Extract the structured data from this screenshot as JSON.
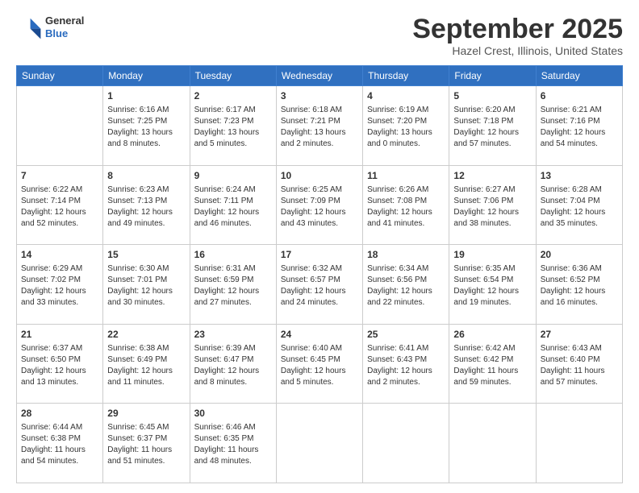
{
  "header": {
    "logo": {
      "line1": "General",
      "line2": "Blue"
    },
    "title": "September 2025",
    "location": "Hazel Crest, Illinois, United States"
  },
  "weekdays": [
    "Sunday",
    "Monday",
    "Tuesday",
    "Wednesday",
    "Thursday",
    "Friday",
    "Saturday"
  ],
  "weeks": [
    [
      {
        "day": "",
        "info": ""
      },
      {
        "day": "1",
        "info": "Sunrise: 6:16 AM\nSunset: 7:25 PM\nDaylight: 13 hours\nand 8 minutes."
      },
      {
        "day": "2",
        "info": "Sunrise: 6:17 AM\nSunset: 7:23 PM\nDaylight: 13 hours\nand 5 minutes."
      },
      {
        "day": "3",
        "info": "Sunrise: 6:18 AM\nSunset: 7:21 PM\nDaylight: 13 hours\nand 2 minutes."
      },
      {
        "day": "4",
        "info": "Sunrise: 6:19 AM\nSunset: 7:20 PM\nDaylight: 13 hours\nand 0 minutes."
      },
      {
        "day": "5",
        "info": "Sunrise: 6:20 AM\nSunset: 7:18 PM\nDaylight: 12 hours\nand 57 minutes."
      },
      {
        "day": "6",
        "info": "Sunrise: 6:21 AM\nSunset: 7:16 PM\nDaylight: 12 hours\nand 54 minutes."
      }
    ],
    [
      {
        "day": "7",
        "info": "Sunrise: 6:22 AM\nSunset: 7:14 PM\nDaylight: 12 hours\nand 52 minutes."
      },
      {
        "day": "8",
        "info": "Sunrise: 6:23 AM\nSunset: 7:13 PM\nDaylight: 12 hours\nand 49 minutes."
      },
      {
        "day": "9",
        "info": "Sunrise: 6:24 AM\nSunset: 7:11 PM\nDaylight: 12 hours\nand 46 minutes."
      },
      {
        "day": "10",
        "info": "Sunrise: 6:25 AM\nSunset: 7:09 PM\nDaylight: 12 hours\nand 43 minutes."
      },
      {
        "day": "11",
        "info": "Sunrise: 6:26 AM\nSunset: 7:08 PM\nDaylight: 12 hours\nand 41 minutes."
      },
      {
        "day": "12",
        "info": "Sunrise: 6:27 AM\nSunset: 7:06 PM\nDaylight: 12 hours\nand 38 minutes."
      },
      {
        "day": "13",
        "info": "Sunrise: 6:28 AM\nSunset: 7:04 PM\nDaylight: 12 hours\nand 35 minutes."
      }
    ],
    [
      {
        "day": "14",
        "info": "Sunrise: 6:29 AM\nSunset: 7:02 PM\nDaylight: 12 hours\nand 33 minutes."
      },
      {
        "day": "15",
        "info": "Sunrise: 6:30 AM\nSunset: 7:01 PM\nDaylight: 12 hours\nand 30 minutes."
      },
      {
        "day": "16",
        "info": "Sunrise: 6:31 AM\nSunset: 6:59 PM\nDaylight: 12 hours\nand 27 minutes."
      },
      {
        "day": "17",
        "info": "Sunrise: 6:32 AM\nSunset: 6:57 PM\nDaylight: 12 hours\nand 24 minutes."
      },
      {
        "day": "18",
        "info": "Sunrise: 6:34 AM\nSunset: 6:56 PM\nDaylight: 12 hours\nand 22 minutes."
      },
      {
        "day": "19",
        "info": "Sunrise: 6:35 AM\nSunset: 6:54 PM\nDaylight: 12 hours\nand 19 minutes."
      },
      {
        "day": "20",
        "info": "Sunrise: 6:36 AM\nSunset: 6:52 PM\nDaylight: 12 hours\nand 16 minutes."
      }
    ],
    [
      {
        "day": "21",
        "info": "Sunrise: 6:37 AM\nSunset: 6:50 PM\nDaylight: 12 hours\nand 13 minutes."
      },
      {
        "day": "22",
        "info": "Sunrise: 6:38 AM\nSunset: 6:49 PM\nDaylight: 12 hours\nand 11 minutes."
      },
      {
        "day": "23",
        "info": "Sunrise: 6:39 AM\nSunset: 6:47 PM\nDaylight: 12 hours\nand 8 minutes."
      },
      {
        "day": "24",
        "info": "Sunrise: 6:40 AM\nSunset: 6:45 PM\nDaylight: 12 hours\nand 5 minutes."
      },
      {
        "day": "25",
        "info": "Sunrise: 6:41 AM\nSunset: 6:43 PM\nDaylight: 12 hours\nand 2 minutes."
      },
      {
        "day": "26",
        "info": "Sunrise: 6:42 AM\nSunset: 6:42 PM\nDaylight: 11 hours\nand 59 minutes."
      },
      {
        "day": "27",
        "info": "Sunrise: 6:43 AM\nSunset: 6:40 PM\nDaylight: 11 hours\nand 57 minutes."
      }
    ],
    [
      {
        "day": "28",
        "info": "Sunrise: 6:44 AM\nSunset: 6:38 PM\nDaylight: 11 hours\nand 54 minutes."
      },
      {
        "day": "29",
        "info": "Sunrise: 6:45 AM\nSunset: 6:37 PM\nDaylight: 11 hours\nand 51 minutes."
      },
      {
        "day": "30",
        "info": "Sunrise: 6:46 AM\nSunset: 6:35 PM\nDaylight: 11 hours\nand 48 minutes."
      },
      {
        "day": "",
        "info": ""
      },
      {
        "day": "",
        "info": ""
      },
      {
        "day": "",
        "info": ""
      },
      {
        "day": "",
        "info": ""
      }
    ]
  ]
}
